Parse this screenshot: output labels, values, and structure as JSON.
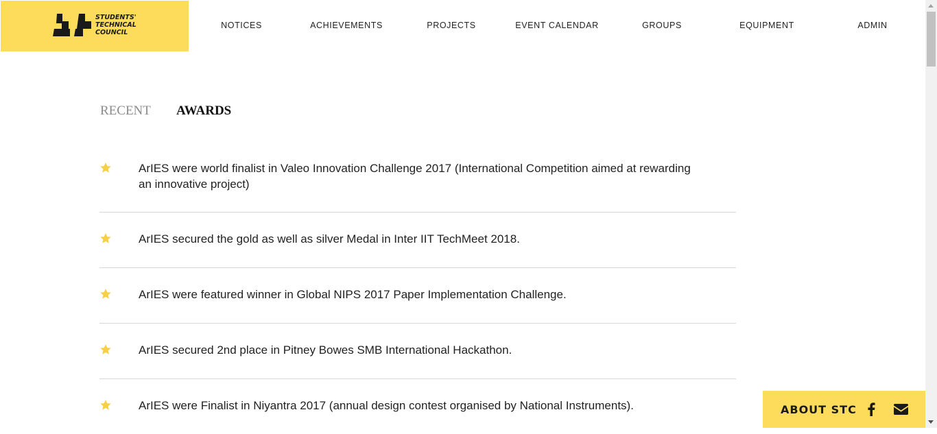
{
  "logo": {
    "lines": [
      "STUDENTS'",
      "TECHNICAL",
      "COUNCIL"
    ]
  },
  "nav": {
    "items": [
      "NOTICES",
      "ACHIEVEMENTS",
      "PROJECTS",
      "EVENT CALENDAR",
      "GROUPS",
      "EQUIPMENT",
      "ADMIN"
    ]
  },
  "tabs": {
    "recent": "RECENT",
    "awards": "AWARDS",
    "active": "AWARDS"
  },
  "awards": [
    {
      "text": "ArIES were world finalist in Valeo Innovation Challenge 2017 (International Competition aimed at rewarding an innovative project)"
    },
    {
      "text": "ArIES secured the gold as well as silver Medal in Inter IIT TechMeet 2018."
    },
    {
      "text": "ArIES were featured winner in Global NIPS 2017 Paper Implementation Challenge."
    },
    {
      "text": "ArIES secured 2nd place in Pitney Bowes SMB International Hackathon."
    },
    {
      "text": "ArIES were Finalist in Niyantra 2017 (annual design contest organised by National Instruments)."
    }
  ],
  "footer": {
    "about_label": "ABOUT STC",
    "icons": [
      "facebook-icon",
      "mail-icon"
    ]
  },
  "colors": {
    "accent": "#fddc5c",
    "star": "#f7d04a",
    "divider": "#d6d6d6",
    "inactive_tab": "#8c8c8c"
  }
}
